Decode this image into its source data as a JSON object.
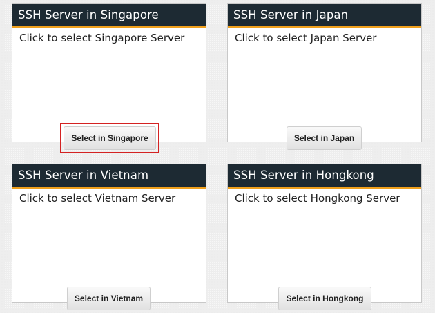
{
  "cards": [
    {
      "title": "SSH Server in Singapore",
      "description": "Click to select Singapore Server",
      "button_label": "Select in Singapore",
      "highlighted": true
    },
    {
      "title": "SSH Server in Japan",
      "description": "Click to select Japan Server",
      "button_label": "Select in Japan",
      "highlighted": false
    },
    {
      "title": "SSH Server in Vietnam",
      "description": "Click to select Vietnam Server",
      "button_label": "Select in Vietnam",
      "highlighted": false
    },
    {
      "title": "SSH Server in Hongkong",
      "description": "Click to select Hongkong Server",
      "button_label": "Select in Hongkong",
      "highlighted": false
    }
  ],
  "colors": {
    "header_background": "#1d2a33",
    "header_accent": "#f0a01c",
    "highlight_border": "#d42222",
    "page_background": "#eeeeee"
  }
}
